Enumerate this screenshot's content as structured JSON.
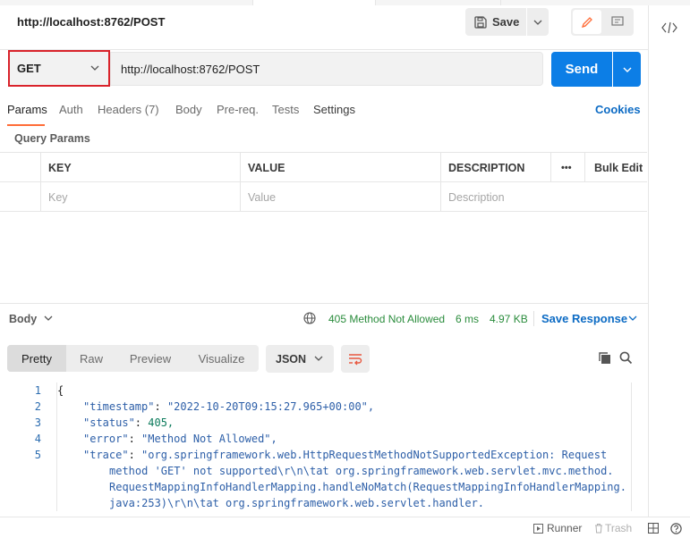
{
  "request": {
    "title": "http://localhost:8762/POST",
    "save_label": "Save",
    "method": "GET",
    "url": "http://localhost:8762/POST",
    "send_label": "Send"
  },
  "request_tabs": [
    {
      "label": "Params",
      "active": true
    },
    {
      "label": "Auth"
    },
    {
      "label": "Headers (7)"
    },
    {
      "label": "Body"
    },
    {
      "label": "Pre-req."
    },
    {
      "label": "Tests"
    },
    {
      "label": "Settings"
    }
  ],
  "cookies_label": "Cookies",
  "query_params": {
    "title": "Query Params",
    "headers": [
      "KEY",
      "VALUE",
      "DESCRIPTION"
    ],
    "more": "•••",
    "bulk_edit": "Bulk Edit",
    "placeholders": {
      "key": "Key",
      "value": "Value",
      "description": "Description"
    }
  },
  "response": {
    "body_label": "Body",
    "status": "405 Method Not Allowed",
    "time": "6 ms",
    "size": "4.97 KB",
    "save_response": "Save Response",
    "view_tabs": [
      "Pretty",
      "Raw",
      "Preview",
      "Visualize"
    ],
    "format": "JSON",
    "lines": [
      {
        "num": "1",
        "text": "{"
      },
      {
        "num": "2",
        "key": "\"timestamp\"",
        "value": "\"2022-10-20T09:15:27.965+00:00\","
      },
      {
        "num": "3",
        "key": "\"status\"",
        "value": "405,"
      },
      {
        "num": "4",
        "key": "\"error\"",
        "value": "\"Method Not Allowed\","
      },
      {
        "num": "5",
        "key": "\"trace\"",
        "value": "\"org.springframework.web.HttpRequestMethodNotSupportedException: Request"
      },
      {
        "num": "",
        "text": "method 'GET' not supported\\r\\n\\tat org.springframework.web.servlet.mvc.method."
      },
      {
        "num": "",
        "text": "RequestMappingInfoHandlerMapping.handleNoMatch(RequestMappingInfoHandlerMapping."
      },
      {
        "num": "",
        "text": "java:253)\\r\\n\\tat org.springframework.web.servlet.handler."
      }
    ]
  },
  "statusbar": {
    "runner": "Runner",
    "trash": "Trash"
  },
  "colors": {
    "send_blue": "#0c7ee6",
    "accent_orange": "#ff6c37",
    "method_border_red": "#d9232b",
    "status_green": "#2a8c3c"
  }
}
